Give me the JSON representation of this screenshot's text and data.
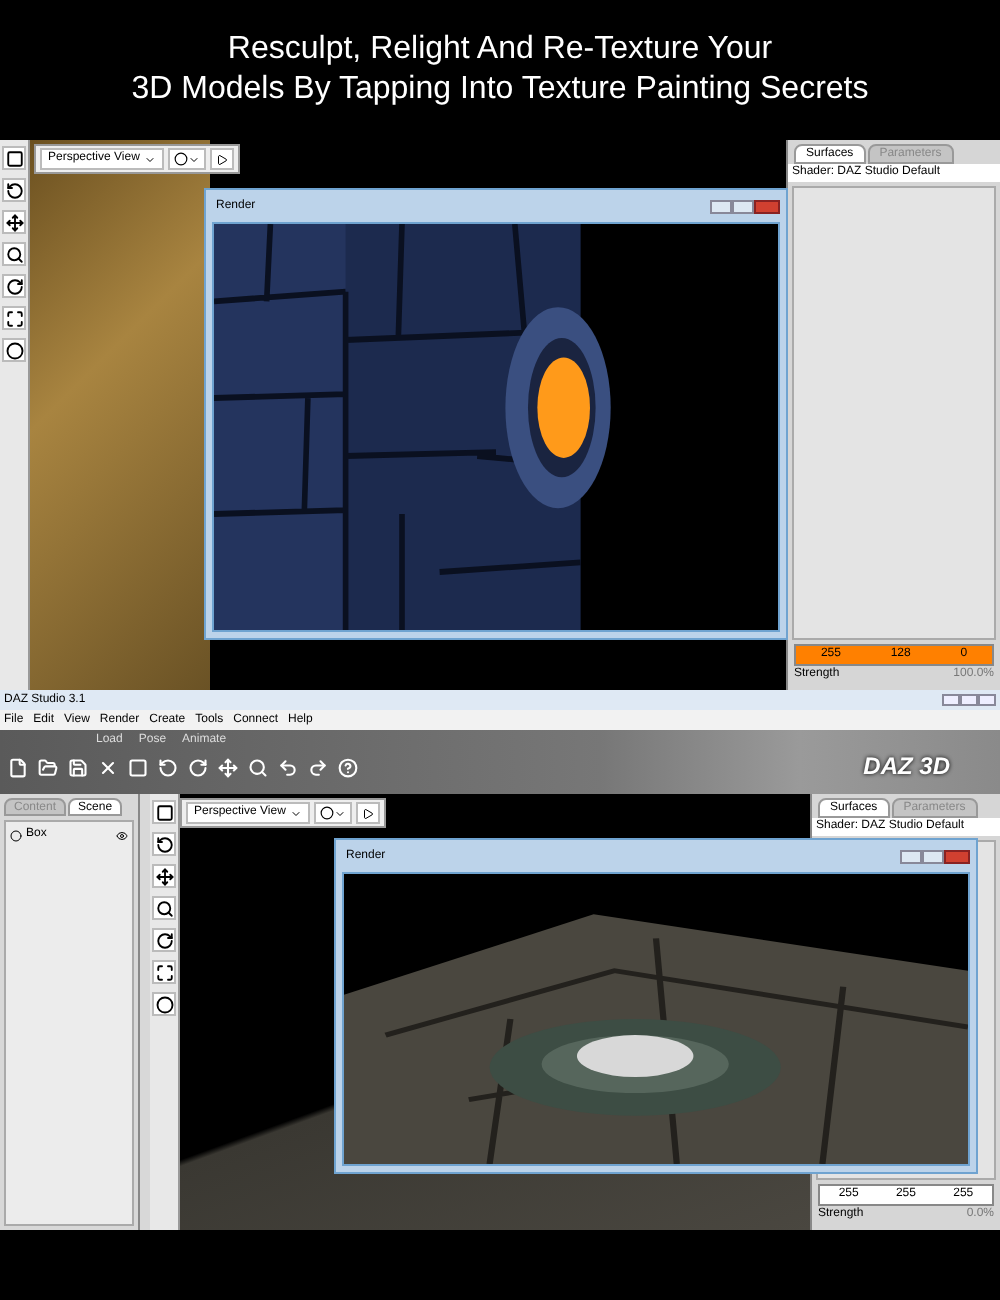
{
  "headline": [
    "Resculpt, Relight And Re-Texture Your",
    "3D Models By Tapping Into Texture Painting Secrets"
  ],
  "screens": [
    {
      "kind": "closeup",
      "view_menu": "Perspective View",
      "render_window": {
        "title": "Render"
      },
      "surfaces_panel": {
        "tabs": [
          {
            "label": "Surfaces",
            "selected": true
          },
          {
            "label": "Parameters",
            "selected": false
          }
        ],
        "shader": "Shader: DAZ Studio Default",
        "color": "#ff8000",
        "color_values": [
          "255",
          "128",
          "0"
        ],
        "strength_label": "Strength",
        "strength": "100.0%"
      }
    },
    {
      "kind": "app",
      "app_title": "DAZ Studio 3.1",
      "menu": [
        "File",
        "Edit",
        "View",
        "Render",
        "Create",
        "Tools",
        "Connect",
        "Help"
      ],
      "rooms": [
        "Load",
        "Pose",
        "Animate"
      ],
      "logo": "DAZ 3D",
      "scene_panel": {
        "tabs": [
          {
            "label": "Content",
            "selected": false
          },
          {
            "label": "Scene",
            "selected": true
          }
        ],
        "items": [
          "Box"
        ]
      },
      "view_menu": "Perspective View",
      "render_window": {
        "title": "Render"
      },
      "surfaces_panel": {
        "tabs": [
          {
            "label": "Surfaces",
            "selected": true
          },
          {
            "label": "Parameters",
            "selected": false
          }
        ],
        "shader": "Shader: DAZ Studio Default",
        "color": "#ffffff",
        "color_values": [
          "255",
          "255",
          "255"
        ],
        "strength_label": "Strength",
        "strength": "0.0%"
      }
    }
  ]
}
